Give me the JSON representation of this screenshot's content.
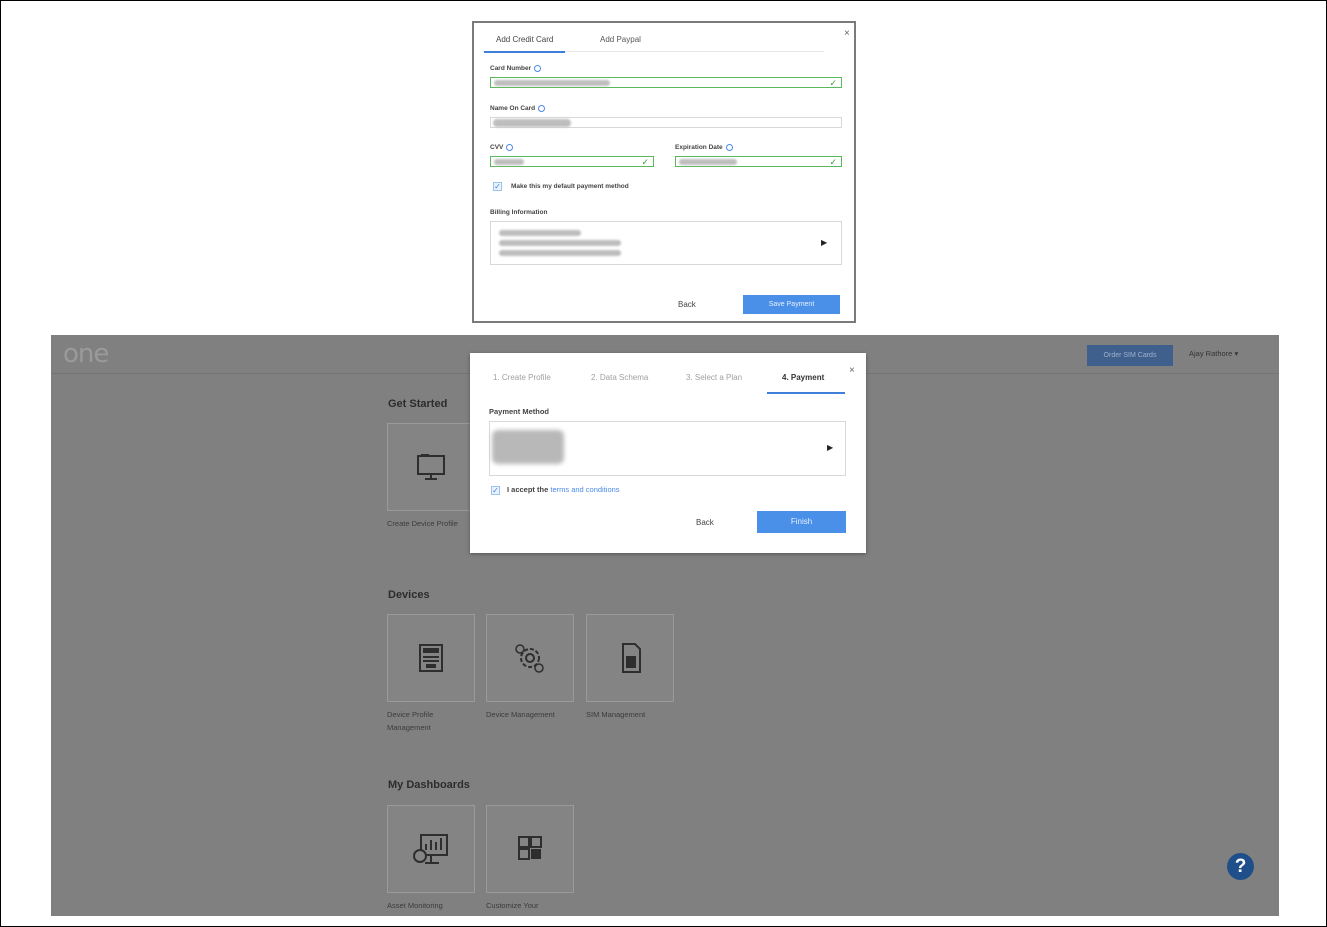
{
  "credit_card_modal": {
    "tabs": [
      "Add Credit Card",
      "Add Paypal"
    ],
    "close": "×",
    "card_number_label": "Card Number",
    "name_on_card_label": "Name On Card",
    "cvv_label": "CVV",
    "expiration_label": "Expiration Date",
    "default_checkbox_label": "Make this my default payment method",
    "default_checked": true,
    "billing_label": "Billing Information",
    "back_label": "Back",
    "save_label": "Save Payment",
    "check_glyph": "✓",
    "arrow_glyph": "▶"
  },
  "app": {
    "logo": "one",
    "order_button": "Order SIM Cards",
    "user_menu": "Ajay Rathore ▾",
    "sections": {
      "get_started": {
        "title": "Get Started",
        "tiles": [
          {
            "label": "Create Device Profile",
            "icon": "device-profile-icon"
          }
        ]
      },
      "devices": {
        "title": "Devices",
        "tiles": [
          {
            "label": "Device Profile Management",
            "icon": "profile-management-icon"
          },
          {
            "label": "Device Management",
            "icon": "gears-icon"
          },
          {
            "label": "SIM Management",
            "icon": "sim-card-icon"
          }
        ]
      },
      "dashboards": {
        "title": "My Dashboards",
        "tiles": [
          {
            "label": "Asset Monitoring",
            "icon": "monitoring-icon"
          },
          {
            "label": "Customize Your",
            "icon": "dashboard-grid-icon"
          }
        ]
      }
    },
    "help": "?"
  },
  "payment_modal": {
    "steps": [
      "1. Create Profile",
      "2. Data Schema",
      "3. Select a Plan",
      "4. Payment"
    ],
    "active_step": 4,
    "close": "×",
    "payment_method_label": "Payment Method",
    "terms_prefix": "I accept the ",
    "terms_link": "terms and conditions",
    "terms_checked": true,
    "back_label": "Back",
    "finish_label": "Finish",
    "arrow_glyph": "▶"
  },
  "colors": {
    "accent": "#4a90e8",
    "valid": "#5cb85c",
    "overlay": "#808080",
    "help": "#1f4f8a"
  }
}
